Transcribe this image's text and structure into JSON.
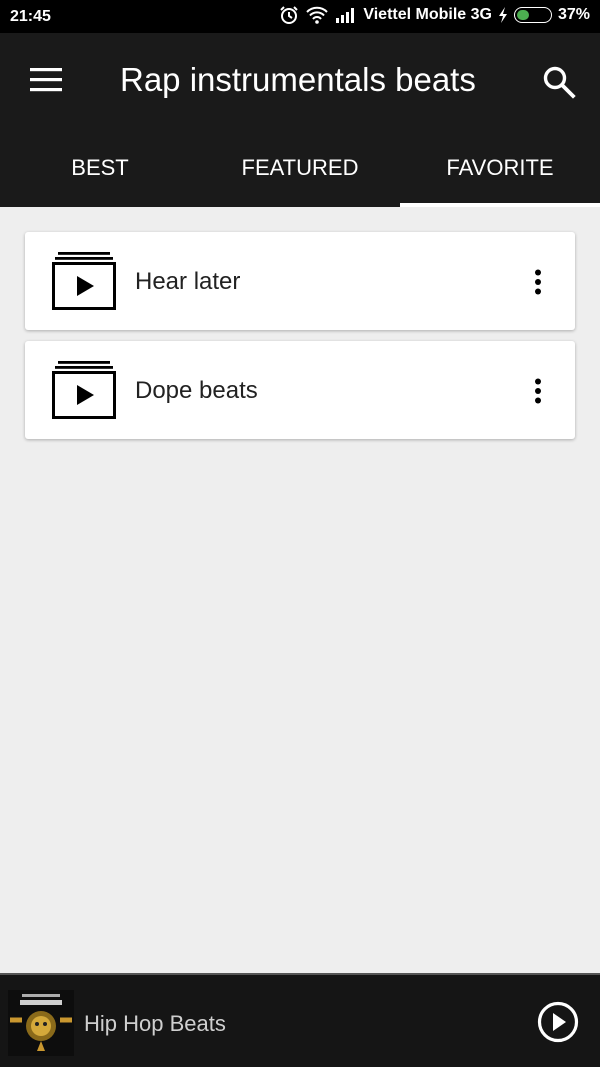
{
  "status_bar": {
    "time": "21:45",
    "carrier": "Viettel Mobile 3G",
    "battery_percent": "37%",
    "battery_level": 0.37,
    "icons": [
      "alarm-icon",
      "wifi-icon",
      "signal-icon",
      "charging-icon",
      "battery-icon"
    ]
  },
  "app_bar": {
    "title": "Rap instrumentals beats",
    "menu_icon": "hamburger-menu-icon",
    "search_icon": "search-icon"
  },
  "tabs": [
    {
      "label": "BEST",
      "active": false
    },
    {
      "label": "FEATURED",
      "active": false
    },
    {
      "label": "FAVORITE",
      "active": true
    }
  ],
  "playlists": [
    {
      "label": "Hear later",
      "icon": "playlist-play-icon",
      "menu_icon": "more-vert-icon"
    },
    {
      "label": "Dope beats",
      "icon": "playlist-play-icon",
      "menu_icon": "more-vert-icon"
    }
  ],
  "player": {
    "title": "Hip Hop Beats",
    "play_icon": "play-circle-icon"
  },
  "colors": {
    "status_bar": "#000000",
    "app_bar": "#1a1a1a",
    "background": "#eeeeee",
    "card": "#ffffff",
    "battery": "#4caf50",
    "player_bar": "#151515"
  }
}
